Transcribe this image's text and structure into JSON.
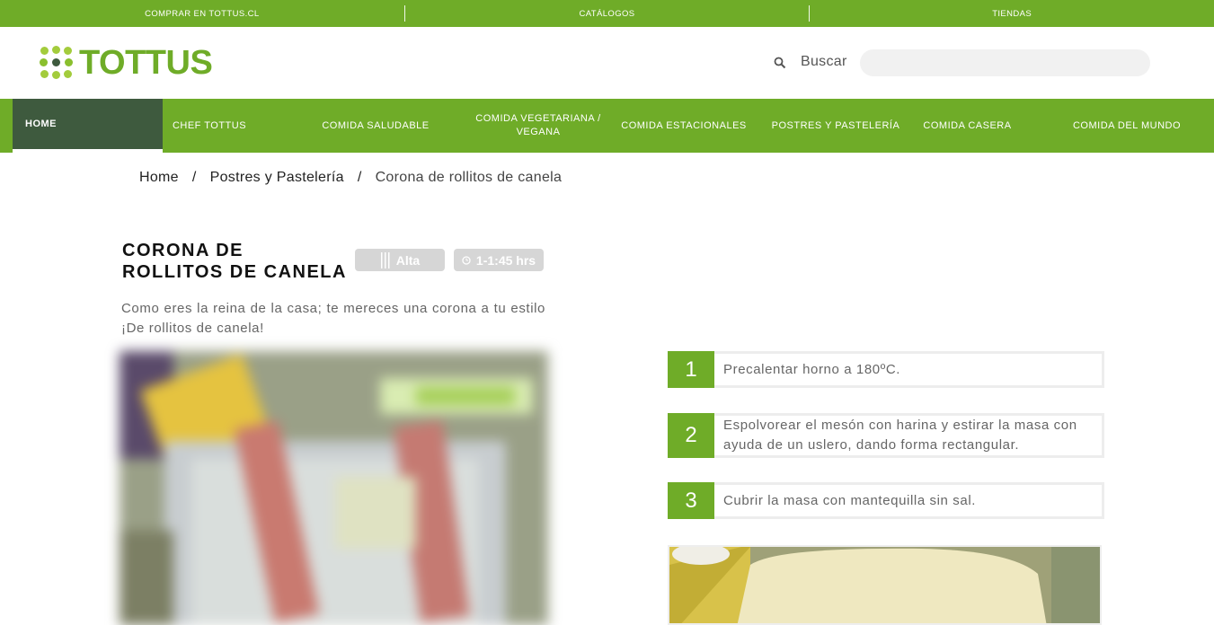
{
  "topbar": {
    "items": [
      {
        "label": "COMPRAR EN TOTTUS.CL"
      },
      {
        "label": "CATÁLOGOS"
      },
      {
        "label": "TIENDAS"
      }
    ]
  },
  "header": {
    "logo_text": "TOTTUS",
    "search_label": "Buscar",
    "search_value": "",
    "brand_color": "#6fac28"
  },
  "nav": {
    "items": [
      {
        "label": "HOME",
        "active": true
      },
      {
        "label": "CHEF TOTTUS"
      },
      {
        "label": "COMIDA SALUDABLE"
      },
      {
        "label": "COMIDA VEGETARIANA / VEGANA"
      },
      {
        "label": "COMIDA ESTACIONALES"
      },
      {
        "label": "POSTRES Y PASTELERÍA"
      },
      {
        "label": "COMIDA CASERA"
      },
      {
        "label": "COMIDA DEL MUNDO"
      }
    ],
    "active_color": "#3e5a3e"
  },
  "breadcrumb": {
    "home": "Home",
    "category": "Postres y Pastelería",
    "current": "Corona de rollitos de canela",
    "separator": "/"
  },
  "recipe": {
    "title_line1": "CORONA DE",
    "title_line2": "ROLLITOS DE CANELA",
    "difficulty": "Alta",
    "time": "1-1:45 hrs",
    "description": "Como eres la reina de la casa; te mereces una corona a tu estilo ¡De rollitos de canela!",
    "main_image_watermark": "TOTTUS"
  },
  "steps": [
    {
      "number": "1",
      "text": "Precalentar horno a 180ºC."
    },
    {
      "number": "2",
      "text": "Espolvorear el mesón con harina y estirar la masa con ayuda de un uslero, dando forma rectangular."
    },
    {
      "number": "3",
      "text": "Cubrir la masa con mantequilla sin sal."
    }
  ]
}
